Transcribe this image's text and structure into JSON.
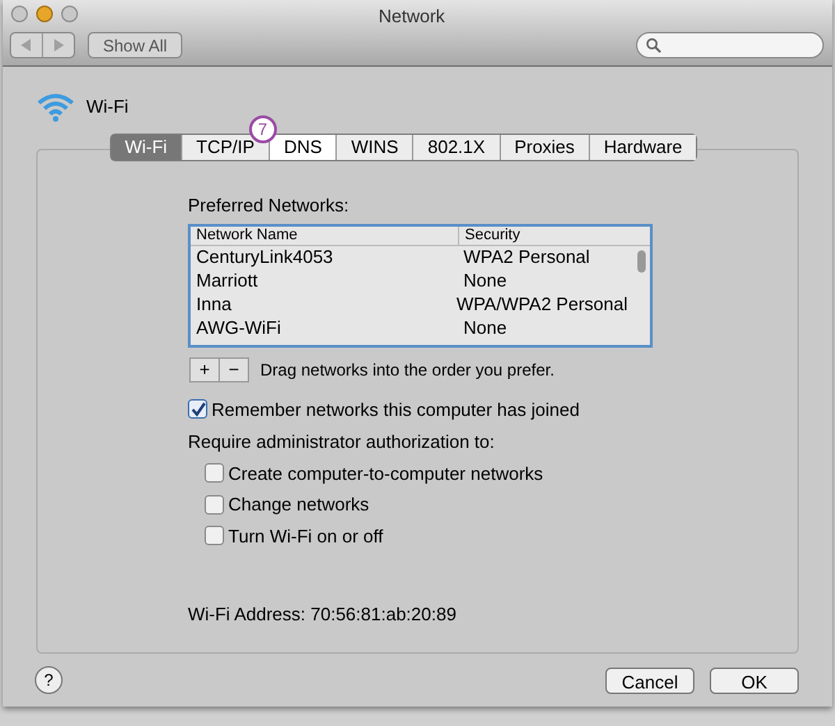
{
  "window": {
    "title": "Network"
  },
  "toolbar": {
    "show_all": "Show All"
  },
  "sheet": {
    "service_name": "Wi-Fi",
    "tabs": [
      {
        "label": "Wi-Fi",
        "selected": true,
        "highlighted": false
      },
      {
        "label": "TCP/IP",
        "selected": false,
        "highlighted": false
      },
      {
        "label": "DNS",
        "selected": false,
        "highlighted": true
      },
      {
        "label": "WINS",
        "selected": false,
        "highlighted": false
      },
      {
        "label": "802.1X",
        "selected": false,
        "highlighted": false
      },
      {
        "label": "Proxies",
        "selected": false,
        "highlighted": false
      },
      {
        "label": "Hardware",
        "selected": false,
        "highlighted": false
      }
    ],
    "annotation": "7",
    "preferred_networks": {
      "title": "Preferred Networks:",
      "columns": [
        "Network Name",
        "Security"
      ],
      "rows": [
        {
          "name": "CenturyLink4053",
          "security": "WPA2 Personal"
        },
        {
          "name": "Marriott",
          "security": "None"
        },
        {
          "name": "Inna",
          "security": "WPA/WPA2 Personal"
        },
        {
          "name": "AWG-WiFi",
          "security": "None"
        }
      ]
    },
    "list_buttons": [
      "+",
      "−"
    ],
    "hint": "Drag networks into the order you prefer.",
    "remember": {
      "label": "Remember networks this computer has joined",
      "checked": true
    },
    "require_label": "Require administrator authorization to:",
    "admin_options": [
      {
        "label": "Create computer-to-computer networks",
        "checked": false
      },
      {
        "label": "Change networks",
        "checked": false
      },
      {
        "label": "Turn Wi-Fi on or off",
        "checked": false
      }
    ],
    "address": "Wi-Fi Address: 70:56:81:ab:20:89",
    "help": "?",
    "cancel_button": "Cancel",
    "ok_button": "OK"
  }
}
